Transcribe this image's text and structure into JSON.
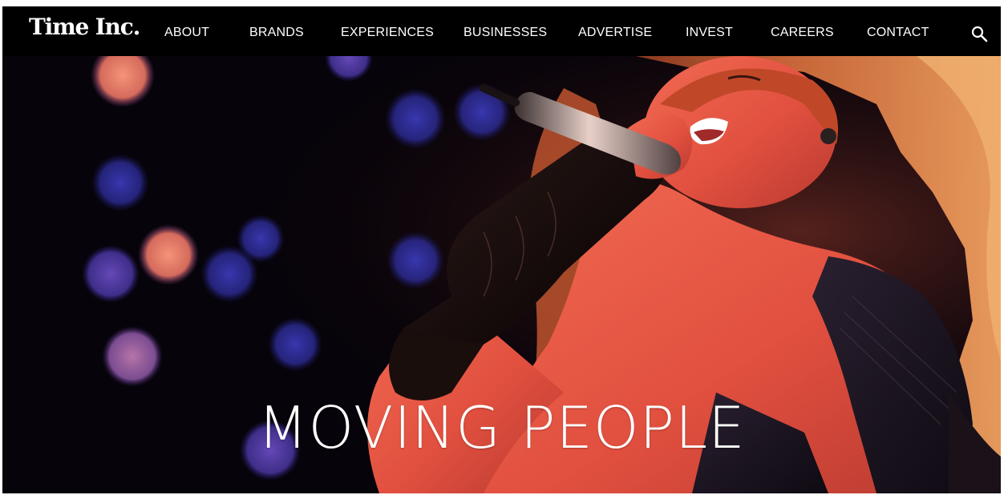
{
  "brand": {
    "logo_text": "Time Inc."
  },
  "nav": {
    "items": [
      {
        "label": "ABOUT"
      },
      {
        "label": "BRANDS"
      },
      {
        "label": "EXPERIENCES"
      },
      {
        "label": "BUSINESSES"
      },
      {
        "label": "ADVERTISE"
      },
      {
        "label": "INVEST"
      },
      {
        "label": "CAREERS"
      },
      {
        "label": "CONTACT"
      }
    ],
    "search_icon": "search-icon"
  },
  "hero": {
    "headline": "MOVING PEOPLE",
    "image_subject": "singer-performing-with-microphone",
    "colors": {
      "background": "#050208",
      "warm_tone": "#e8503e",
      "bokeh_blue": "#3a3aa8",
      "bokeh_pink": "#f08068"
    }
  },
  "colors": {
    "nav_background": "#000000",
    "nav_text": "#ffffff",
    "headline": "#ffffff"
  }
}
